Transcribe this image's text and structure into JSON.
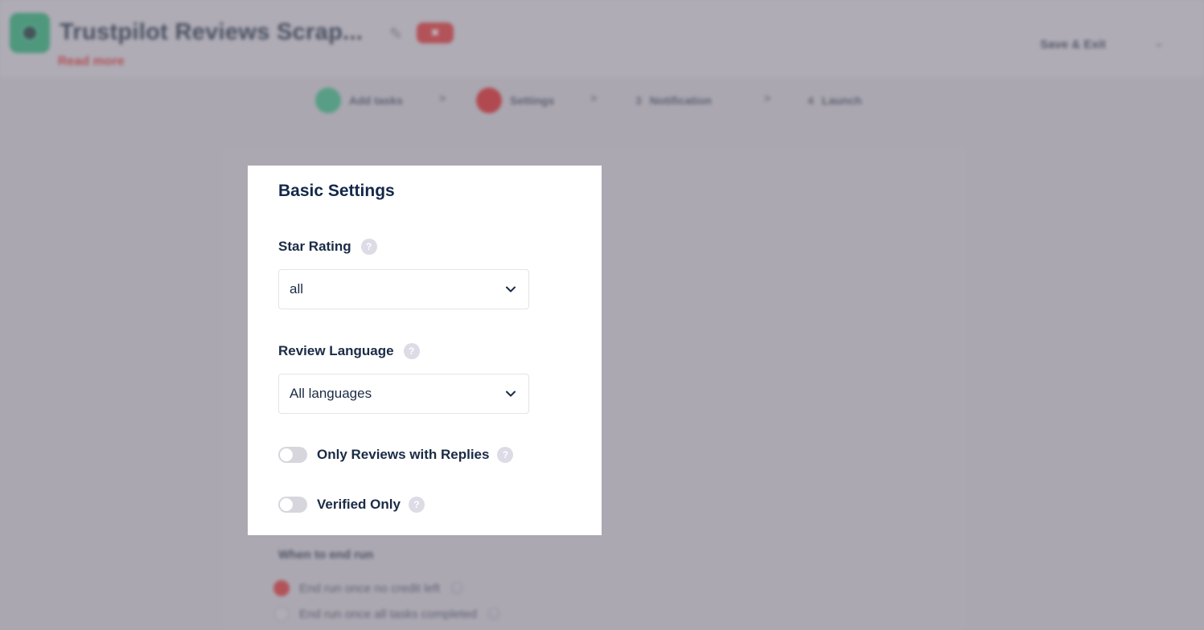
{
  "app": {
    "title": "Trustpilot Reviews Scrap...",
    "badge": "✖",
    "read_more": "Read more",
    "save_exit": "Save & Exit",
    "more_chevron": "⌄"
  },
  "steps": [
    {
      "label": "Add tasks",
      "status": "complete",
      "color": "#3fc08a"
    },
    {
      "label": "Settings",
      "status": "error",
      "color": "#e02828"
    },
    {
      "number": "3",
      "label": "Notification"
    },
    {
      "number": "4",
      "label": "Launch"
    }
  ],
  "step_separator": ">",
  "background_section": {
    "title": "When to end run",
    "options": [
      {
        "label": "End run once no credit left",
        "checked": true
      },
      {
        "label": "End run once all tasks completed",
        "checked": false
      }
    ]
  },
  "panel": {
    "title": "Basic Settings",
    "star_rating": {
      "label": "Star Rating",
      "value": "all"
    },
    "review_language": {
      "label": "Review Language",
      "value": "All languages"
    },
    "toggles": [
      {
        "label": "Only Reviews with Replies",
        "on": false
      },
      {
        "label": "Verified Only",
        "on": false
      }
    ],
    "help_glyph": "?"
  },
  "colors": {
    "accent_red": "#e23a3a",
    "accent_green": "#3fc08a",
    "text_dark": "#13284a"
  }
}
